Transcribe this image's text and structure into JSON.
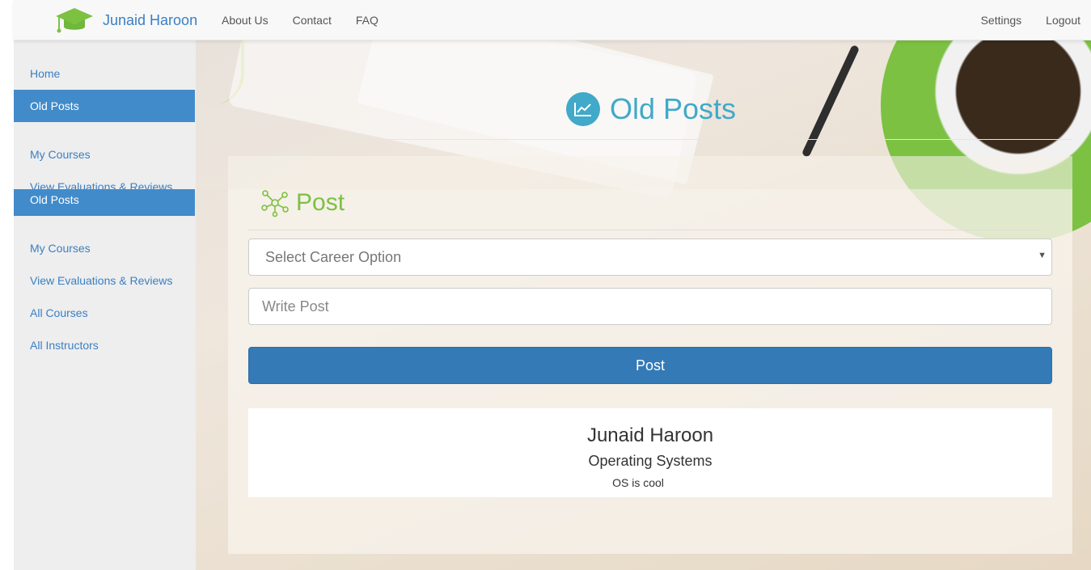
{
  "navbar": {
    "brand_name": "Junaid Haroon",
    "links": [
      "About Us",
      "Contact",
      "FAQ"
    ],
    "right_links": [
      "Settings",
      "Logout"
    ]
  },
  "sidebar": {
    "items": [
      "Home",
      "Old Posts",
      "My Courses",
      "View Evaluations & Reviews",
      "All Courses",
      "All Instructors"
    ],
    "active": "Old Posts"
  },
  "page": {
    "title": "Old Posts"
  },
  "post_form": {
    "heading": "Post",
    "career_select_placeholder": "Select Career Option",
    "post_input_placeholder": "Write Post",
    "submit_label": "Post"
  },
  "posts": [
    {
      "author": "Junaid Haroon",
      "course": "Operating Systems",
      "body": "OS is cool"
    }
  ],
  "colors": {
    "brand": "#3a7fc4",
    "accent_teal": "#41a9c9",
    "accent_green": "#7cc142",
    "button_primary": "#337ab7",
    "sidebar_active": "#428bca"
  }
}
